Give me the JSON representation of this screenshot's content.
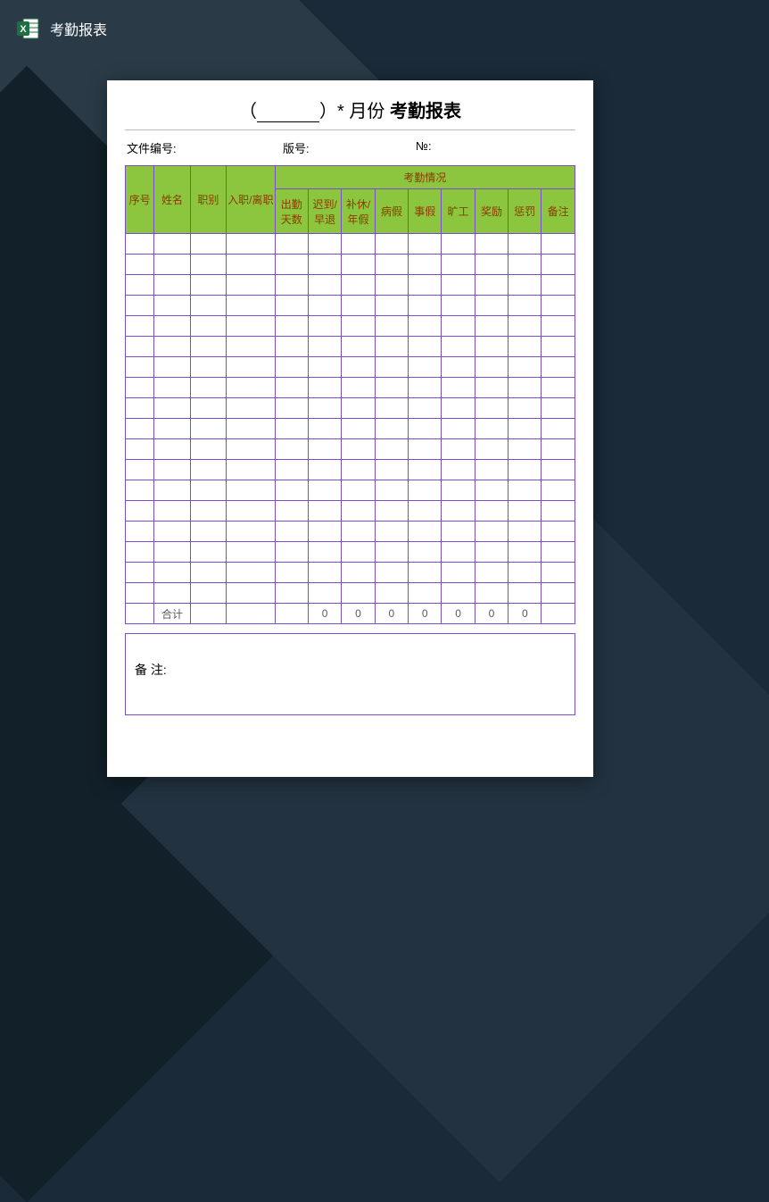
{
  "app": {
    "file_title": "考勤报表"
  },
  "document": {
    "title_prefix": "（______）* 月份",
    "title_main": "考勤报表",
    "meta": {
      "doc_no_label": "文件编号:",
      "edition_label": "版号:",
      "serial_label": "№:"
    },
    "headers": {
      "seq": "序号",
      "name": "姓名",
      "role": "职别",
      "hire_leave": "入职/离职",
      "attendance_group": "考勤情况",
      "days_present": "出勤天数",
      "late_early": "迟到/早退",
      "comp_annual": "补休/年假",
      "sick": "病假",
      "personal": "事假",
      "absent": "旷工",
      "reward": "奖励",
      "penalty": "惩罚",
      "remark": "备注"
    },
    "totals": {
      "label": "合计",
      "values": [
        "",
        "0",
        "0",
        "0",
        "0",
        "0",
        "0",
        "0",
        ""
      ]
    },
    "notes_label": "备  注:"
  }
}
